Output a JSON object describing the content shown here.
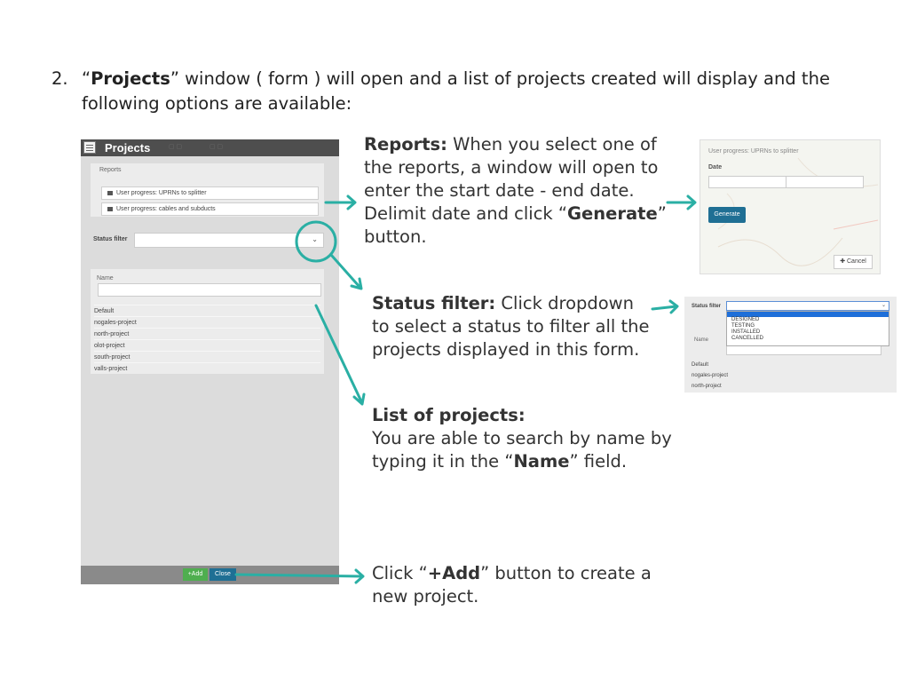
{
  "heading": {
    "number": "2.",
    "before": "“",
    "bold": "Projects",
    "after": "” window ( form ) will open and a list of projects created will display and the following options are available:"
  },
  "projects_window": {
    "title": "Projects",
    "reports_label": "Reports",
    "report_buttons": [
      "User progress: UPRNs to splitter",
      "User progress: cables and subducts"
    ],
    "status_filter_label": "Status filter",
    "name_label": "Name",
    "projects": [
      "Default",
      "nogales-project",
      "north-project",
      "olot-project",
      "south-project",
      "valls-project"
    ],
    "add_button": "+Add",
    "close_button": "Close"
  },
  "reports_text": {
    "bold": "Reports:",
    "text1": " When you select one of the reports, a window will open to enter the start date - end date. Delimit date and click “",
    "bold2": "Generate",
    "text2": "” button."
  },
  "reports_dialog": {
    "title": "User progress: UPRNs to splitter",
    "date_label": "Date",
    "generate_button": "Generate",
    "cancel_button": "Cancel"
  },
  "status_text": {
    "bold": "Status filter:",
    "text": " Click dropdown to select a status to filter all the projects displayed in this form."
  },
  "status_dialog": {
    "label": "Status filter",
    "options": [
      "DESIGNED",
      "TESTING",
      "INSTALLED",
      "CANCELLED"
    ],
    "name_label": "Name",
    "projects": [
      "Default",
      "nogales-project",
      "north-project"
    ]
  },
  "list_text": {
    "bold": "List of projects:",
    "line": "You are able to search by name by typing it in the “",
    "bold2": "Name",
    "after": "” field."
  },
  "add_text": {
    "before": "Click “",
    "bold": "+Add",
    "after": "” button to create a new project."
  },
  "colors": {
    "arrow": "#2aafa4",
    "close_button": "#1f6f94",
    "add_button": "#4fae4f"
  }
}
